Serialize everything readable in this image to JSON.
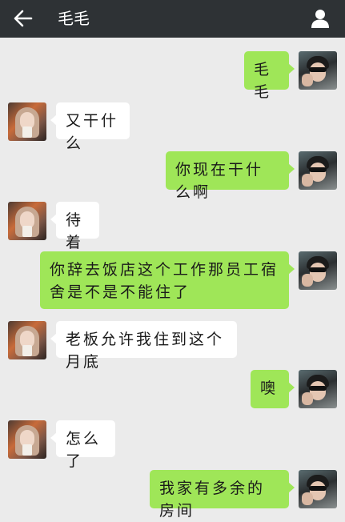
{
  "header": {
    "title": "毛毛",
    "back_icon": "arrow-left-icon",
    "profile_icon": "person-icon",
    "background": "#2e3235"
  },
  "colors": {
    "sent_bubble": "#9fe658",
    "received_bubble": "#ffffff",
    "chat_background": "#ebebeb"
  },
  "messages": [
    {
      "sender": "me",
      "text": "毛毛"
    },
    {
      "sender": "other",
      "text": "又干什么"
    },
    {
      "sender": "me",
      "text": "你现在干什么啊"
    },
    {
      "sender": "other",
      "text": "待着"
    },
    {
      "sender": "me",
      "text": "你辞去饭店这个工作那员工宿舍是不是不能住了"
    },
    {
      "sender": "other",
      "text": "老板允许我住到这个月底"
    },
    {
      "sender": "me",
      "text": "噢"
    },
    {
      "sender": "other",
      "text": "怎么了"
    },
    {
      "sender": "me",
      "text": "我家有多余的房间"
    }
  ]
}
